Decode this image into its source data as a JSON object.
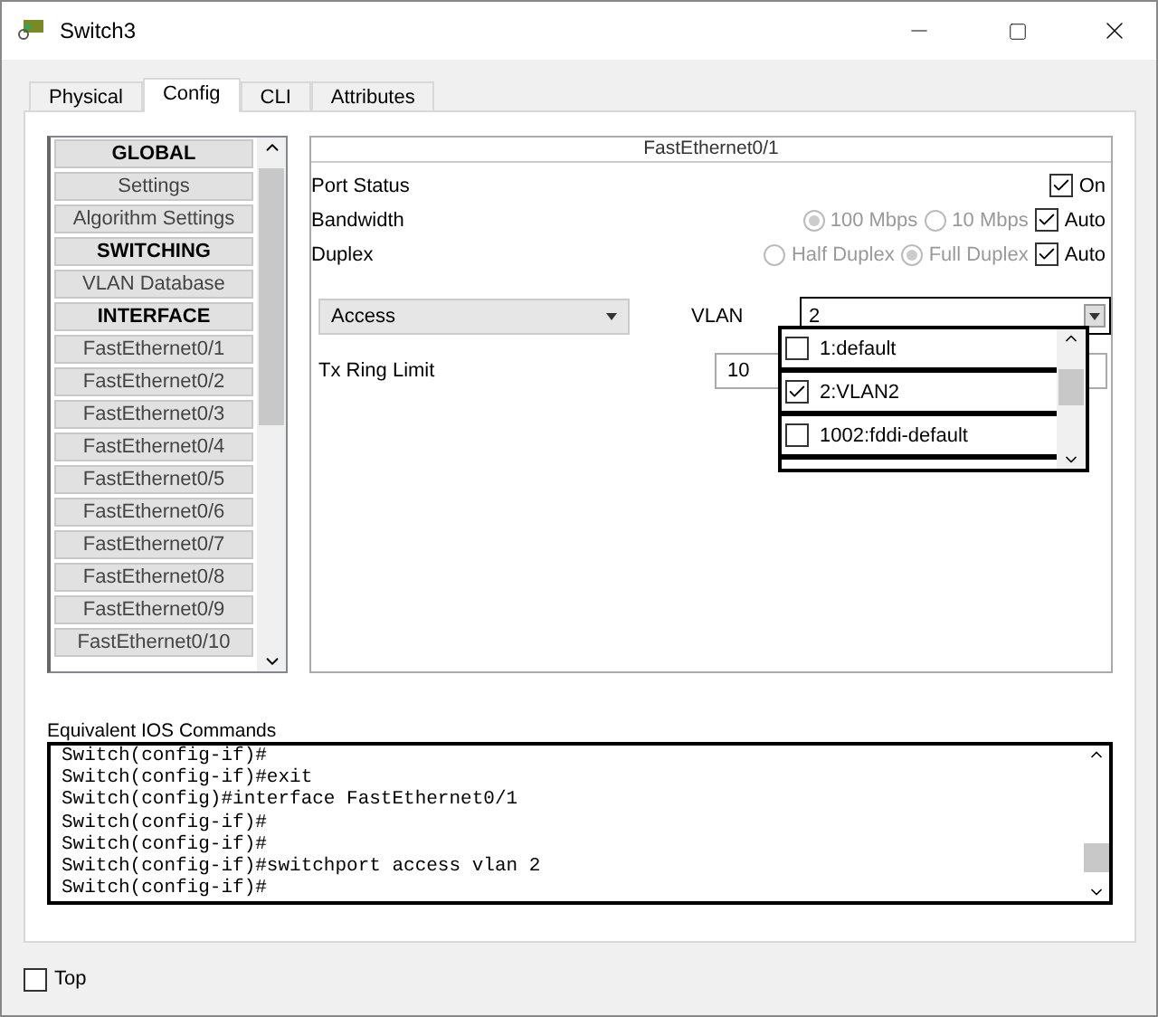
{
  "window": {
    "title": "Switch3"
  },
  "tabs": [
    {
      "label": "Physical",
      "selected": false
    },
    {
      "label": "Config",
      "selected": true
    },
    {
      "label": "CLI",
      "selected": false
    },
    {
      "label": "Attributes",
      "selected": false
    }
  ],
  "sidebar": {
    "items": [
      {
        "label": "GLOBAL",
        "kind": "header"
      },
      {
        "label": "Settings",
        "kind": "item"
      },
      {
        "label": "Algorithm Settings",
        "kind": "item"
      },
      {
        "label": "SWITCHING",
        "kind": "header"
      },
      {
        "label": "VLAN Database",
        "kind": "item"
      },
      {
        "label": "INTERFACE",
        "kind": "header"
      },
      {
        "label": "FastEthernet0/1",
        "kind": "item"
      },
      {
        "label": "FastEthernet0/2",
        "kind": "item"
      },
      {
        "label": "FastEthernet0/3",
        "kind": "item"
      },
      {
        "label": "FastEthernet0/4",
        "kind": "item"
      },
      {
        "label": "FastEthernet0/5",
        "kind": "item"
      },
      {
        "label": "FastEthernet0/6",
        "kind": "item"
      },
      {
        "label": "FastEthernet0/7",
        "kind": "item"
      },
      {
        "label": "FastEthernet0/8",
        "kind": "item"
      },
      {
        "label": "FastEthernet0/9",
        "kind": "item"
      },
      {
        "label": "FastEthernet0/10",
        "kind": "item"
      }
    ]
  },
  "port": {
    "title": "FastEthernet0/1",
    "rows": [
      {
        "label": "Port Status",
        "options": [
          {
            "kind": "checkbox",
            "label": "On",
            "checked": true
          }
        ]
      },
      {
        "label": "Bandwidth",
        "options": [
          {
            "kind": "radio",
            "label": "100 Mbps",
            "selected": true,
            "disabled": true
          },
          {
            "kind": "radio",
            "label": "10 Mbps",
            "selected": false,
            "disabled": true
          },
          {
            "kind": "checkbox",
            "label": "Auto",
            "checked": true
          }
        ]
      },
      {
        "label": "Duplex",
        "options": [
          {
            "kind": "radio",
            "label": "Half Duplex",
            "selected": false,
            "disabled": true
          },
          {
            "kind": "radio",
            "label": "Full Duplex",
            "selected": true,
            "disabled": true
          },
          {
            "kind": "checkbox",
            "label": "Auto",
            "checked": true
          }
        ]
      }
    ],
    "mode": {
      "value": "Access"
    },
    "vlan": {
      "label": "VLAN",
      "value": "2",
      "expanded": true,
      "options": [
        {
          "label": "1:default",
          "checked": false
        },
        {
          "label": "2:VLAN2",
          "checked": true
        },
        {
          "label": "1002:fddi-default",
          "checked": false
        }
      ]
    },
    "tx_ring": {
      "label": "Tx Ring Limit",
      "value": "10"
    }
  },
  "console": {
    "label": "Equivalent IOS Commands",
    "lines": [
      "Switch(config-if)#",
      "Switch(config-if)#exit",
      "Switch(config)#interface FastEthernet0/1",
      "Switch(config-if)#",
      "Switch(config-if)#",
      "Switch(config-if)#switchport access vlan 2",
      "Switch(config-if)#"
    ]
  },
  "top": {
    "label": "Top",
    "checked": false
  }
}
